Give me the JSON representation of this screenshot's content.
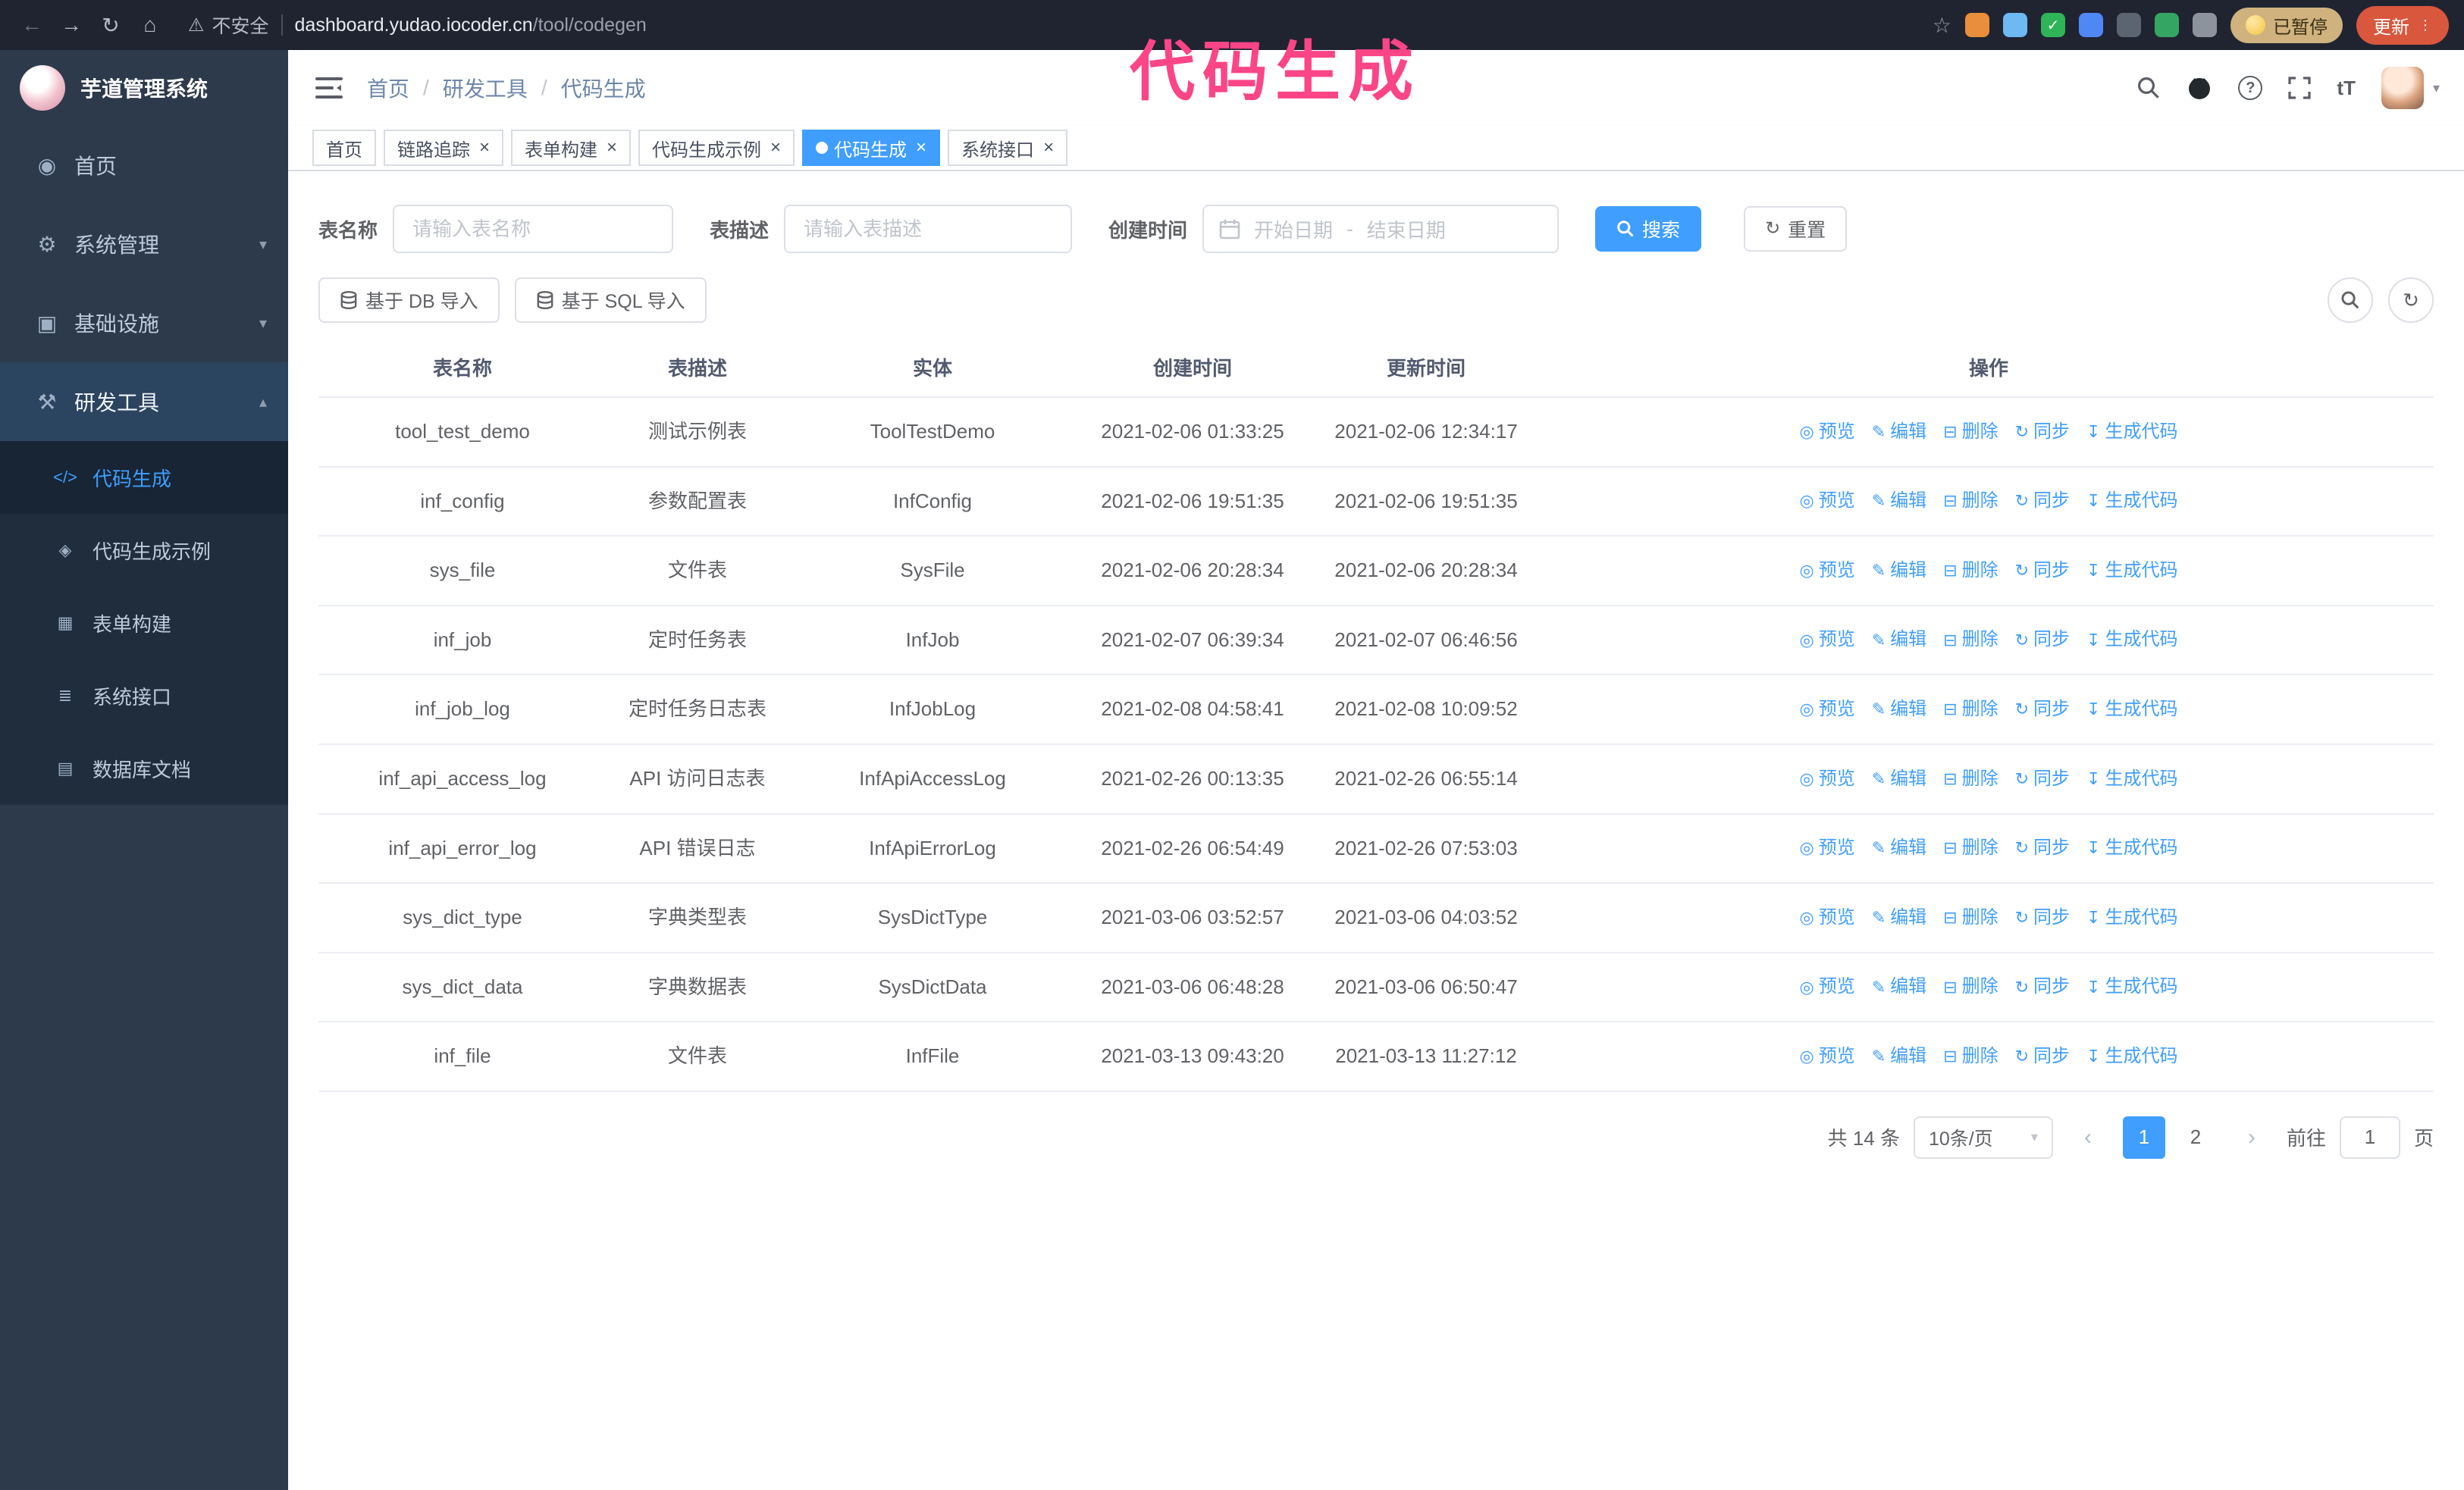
{
  "theme": {
    "accent": "#409eff"
  },
  "annotation": {
    "text": "代码生成",
    "color": "#fb4586"
  },
  "browser": {
    "warning_text": "不安全",
    "url_host": "dashboard.yudao.iocoder.cn",
    "url_path": "/tool/codegen",
    "paused_badge": "已暂停",
    "update_label": "更新",
    "extensions": [
      {
        "name": "fox-extension-icon",
        "color": "#e98e3c"
      },
      {
        "name": "drop-extension-icon",
        "color": "#6fb9f2"
      },
      {
        "name": "check-extension-icon",
        "color": "#2fb457",
        "glyph": "✓"
      },
      {
        "name": "people-extension-icon",
        "color": "#4f87f5"
      },
      {
        "name": "card-extension-icon",
        "color": "#5b6470"
      },
      {
        "name": "leaf-extension-icon",
        "color": "#35a564"
      },
      {
        "name": "puzzle-extension-icon",
        "color": "#8d939c"
      }
    ]
  },
  "sidebar": {
    "logo_title": "芋道管理系统",
    "items": [
      {
        "key": "home",
        "label": "首页",
        "icon": "dashboard-icon"
      },
      {
        "key": "system",
        "label": "系统管理",
        "icon": "gear-icon",
        "chevron": "down"
      },
      {
        "key": "infra",
        "label": "基础设施",
        "icon": "infra-icon",
        "chevron": "down"
      },
      {
        "key": "devtools",
        "label": "研发工具",
        "icon": "tools-icon",
        "chevron": "up",
        "expanded": true
      }
    ],
    "subitems": [
      {
        "key": "codegen",
        "label": "代码生成",
        "icon": "code-icon",
        "active": true
      },
      {
        "key": "codegen-example",
        "label": "代码生成示例",
        "icon": "example-icon"
      },
      {
        "key": "form-builder",
        "label": "表单构建",
        "icon": "form-icon"
      },
      {
        "key": "api",
        "label": "系统接口",
        "icon": "api-icon"
      },
      {
        "key": "db-doc",
        "label": "数据库文档",
        "icon": "db-doc-icon"
      }
    ]
  },
  "header": {
    "breadcrumb": [
      "首页",
      "研发工具",
      "代码生成"
    ]
  },
  "tabs": [
    {
      "label": "首页",
      "closable": false,
      "active": false
    },
    {
      "label": "链路追踪",
      "closable": true,
      "active": false
    },
    {
      "label": "表单构建",
      "closable": true,
      "active": false
    },
    {
      "label": "代码生成示例",
      "closable": true,
      "active": false
    },
    {
      "label": "代码生成",
      "closable": true,
      "active": true
    },
    {
      "label": "系统接口",
      "closable": true,
      "active": false
    }
  ],
  "filters": {
    "table_name_label": "表名称",
    "table_name_placeholder": "请输入表名称",
    "table_desc_label": "表描述",
    "table_desc_placeholder": "请输入表描述",
    "create_time_label": "创建时间",
    "start_date_placeholder": "开始日期",
    "range_separator": "-",
    "end_date_placeholder": "结束日期",
    "search_label": "搜索",
    "reset_label": "重置"
  },
  "toolbar": {
    "import_db_label": "基于 DB 导入",
    "import_sql_label": "基于 SQL 导入"
  },
  "table": {
    "columns": [
      "表名称",
      "表描述",
      "实体",
      "创建时间",
      "更新时间",
      "操作"
    ],
    "actions": [
      {
        "key": "preview",
        "label": "预览",
        "icon": "eye-icon"
      },
      {
        "key": "edit",
        "label": "编辑",
        "icon": "edit-icon"
      },
      {
        "key": "delete",
        "label": "删除",
        "icon": "delete-icon"
      },
      {
        "key": "sync",
        "label": "同步",
        "icon": "sync-icon"
      },
      {
        "key": "generate",
        "label": "生成代码",
        "icon": "download-icon"
      }
    ],
    "rows": [
      {
        "name": "tool_test_demo",
        "desc": "测试示例表",
        "entity": "ToolTestDemo",
        "created": "2021-02-06 01:33:25",
        "updated": "2021-02-06 12:34:17"
      },
      {
        "name": "inf_config",
        "desc": "参数配置表",
        "entity": "InfConfig",
        "created": "2021-02-06 19:51:35",
        "updated": "2021-02-06 19:51:35"
      },
      {
        "name": "sys_file",
        "desc": "文件表",
        "entity": "SysFile",
        "created": "2021-02-06 20:28:34",
        "updated": "2021-02-06 20:28:34"
      },
      {
        "name": "inf_job",
        "desc": "定时任务表",
        "entity": "InfJob",
        "created": "2021-02-07 06:39:34",
        "updated": "2021-02-07 06:46:56"
      },
      {
        "name": "inf_job_log",
        "desc": "定时任务日志表",
        "entity": "InfJobLog",
        "created": "2021-02-08 04:58:41",
        "updated": "2021-02-08 10:09:52"
      },
      {
        "name": "inf_api_access_log",
        "desc": "API 访问日志表",
        "entity": "InfApiAccessLog",
        "created": "2021-02-26 00:13:35",
        "updated": "2021-02-26 06:55:14"
      },
      {
        "name": "inf_api_error_log",
        "desc": "API 错误日志",
        "entity": "InfApiErrorLog",
        "created": "2021-02-26 06:54:49",
        "updated": "2021-02-26 07:53:03"
      },
      {
        "name": "sys_dict_type",
        "desc": "字典类型表",
        "entity": "SysDictType",
        "created": "2021-03-06 03:52:57",
        "updated": "2021-03-06 04:03:52"
      },
      {
        "name": "sys_dict_data",
        "desc": "字典数据表",
        "entity": "SysDictData",
        "created": "2021-03-06 06:48:28",
        "updated": "2021-03-06 06:50:47"
      },
      {
        "name": "inf_file",
        "desc": "文件表",
        "entity": "InfFile",
        "created": "2021-03-13 09:43:20",
        "updated": "2021-03-13 11:27:12"
      }
    ]
  },
  "pagination": {
    "total_text": "共 14 条",
    "page_size": "10条/页",
    "pages": [
      "1",
      "2"
    ],
    "active_page": "1",
    "goto_label": "前往",
    "goto_value": "1",
    "goto_unit": "页"
  }
}
